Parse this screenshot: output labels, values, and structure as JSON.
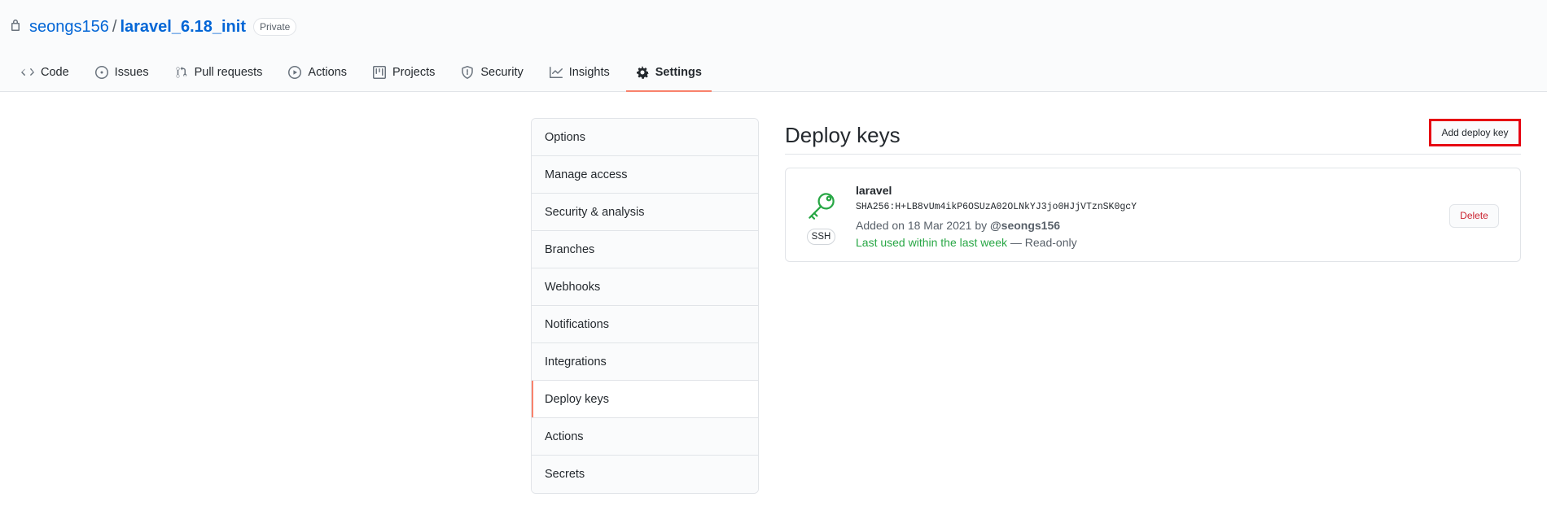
{
  "repo": {
    "owner": "seongs156",
    "separator": "/",
    "name": "laravel_6.18_init",
    "visibility": "Private"
  },
  "tabs": [
    {
      "label": "Code",
      "icon": "code-icon"
    },
    {
      "label": "Issues",
      "icon": "issue-icon"
    },
    {
      "label": "Pull requests",
      "icon": "pull-request-icon"
    },
    {
      "label": "Actions",
      "icon": "play-icon"
    },
    {
      "label": "Projects",
      "icon": "project-icon"
    },
    {
      "label": "Security",
      "icon": "shield-icon"
    },
    {
      "label": "Insights",
      "icon": "graph-icon"
    },
    {
      "label": "Settings",
      "icon": "gear-icon",
      "selected": true
    }
  ],
  "menu": [
    {
      "label": "Options"
    },
    {
      "label": "Manage access"
    },
    {
      "label": "Security & analysis"
    },
    {
      "label": "Branches"
    },
    {
      "label": "Webhooks"
    },
    {
      "label": "Notifications"
    },
    {
      "label": "Integrations"
    },
    {
      "label": "Deploy keys",
      "selected": true
    },
    {
      "label": "Actions"
    },
    {
      "label": "Secrets"
    }
  ],
  "main": {
    "title": "Deploy keys",
    "add_button": "Add deploy key",
    "key": {
      "title": "laravel",
      "type_label": "SSH",
      "fingerprint": "SHA256:H+LB8vUm4ikP6OSUzA02OLNkYJ3jo0HJjVTznSK0gcY",
      "added_text": "Added on 18 Mar 2021 by ",
      "added_by": "@seongs156",
      "last_used": "Last used within the last week",
      "access": " — Read-only",
      "delete_label": "Delete"
    }
  },
  "colors": {
    "link": "#0366d6",
    "tab_underline": "#f9826c",
    "success": "#28a745",
    "danger": "#cb2431",
    "highlight_box": "#e60012"
  }
}
